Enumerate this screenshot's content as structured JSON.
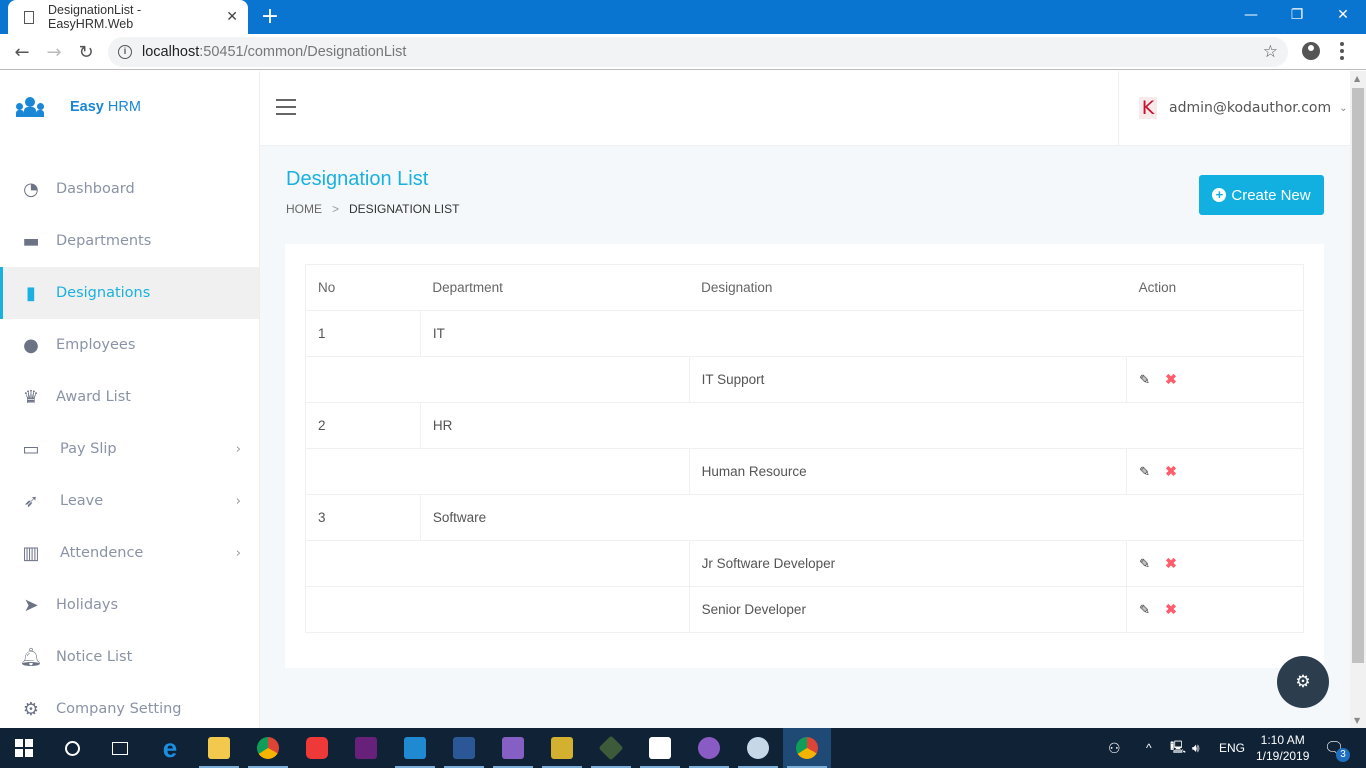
{
  "browser": {
    "tab_title": "DesignationList - EasyHRM.Web",
    "url_host": "localhost",
    "url_rest": ":50451/common/DesignationList",
    "new_tab": "+",
    "close_tab": "✕"
  },
  "brand": {
    "bold": "Easy",
    "rest": " HRM"
  },
  "sidebar": {
    "items": [
      {
        "label": "Dashboard",
        "icon": "dashboard-icon",
        "glyph": "◔",
        "active": false,
        "submenu": false
      },
      {
        "label": "Departments",
        "icon": "briefcase-icon",
        "glyph": "▬",
        "active": false,
        "submenu": false
      },
      {
        "label": "Designations",
        "icon": "suitcase-icon",
        "glyph": "▮",
        "active": true,
        "submenu": false
      },
      {
        "label": "Employees",
        "icon": "users-icon",
        "glyph": "●",
        "active": false,
        "submenu": false
      },
      {
        "label": "Award List",
        "icon": "trophy-icon",
        "glyph": "♛",
        "active": false,
        "submenu": false
      },
      {
        "label": "Pay Slip",
        "icon": "money-icon",
        "glyph": "▭",
        "active": false,
        "submenu": true
      },
      {
        "label": "Leave",
        "icon": "rocket-icon",
        "glyph": "➶",
        "active": false,
        "submenu": true
      },
      {
        "label": "Attendence",
        "icon": "bar-chart-icon",
        "glyph": "▥",
        "active": false,
        "submenu": true
      },
      {
        "label": "Holidays",
        "icon": "paper-plane-icon",
        "glyph": "➤",
        "active": false,
        "submenu": false
      },
      {
        "label": "Notice List",
        "icon": "bell-icon",
        "glyph": "🔔︎",
        "active": false,
        "submenu": false
      },
      {
        "label": "Company Setting",
        "icon": "gear-icon",
        "glyph": "⚙",
        "active": false,
        "submenu": false
      }
    ],
    "chevron": "›"
  },
  "topbar": {
    "user_initial": "K",
    "user_email": "admin@kodauthor.com",
    "caret": "⌄"
  },
  "page": {
    "title": "Designation List",
    "breadcrumb": {
      "home": "HOME",
      "separator": ">",
      "current": "DESIGNATION LIST"
    },
    "create_button": "Create New"
  },
  "table": {
    "headers": [
      "No",
      "Department",
      "Designation",
      "Action"
    ],
    "groups": [
      {
        "no": "1",
        "department": "IT",
        "designations": [
          "IT Support"
        ]
      },
      {
        "no": "2",
        "department": "HR",
        "designations": [
          "Human Resource"
        ]
      },
      {
        "no": "3",
        "department": "Software",
        "designations": [
          "Jr Software Developer",
          "Senior Developer"
        ]
      }
    ],
    "edit_glyph": "✎",
    "delete_glyph": "✖"
  },
  "fab_glyph": "⚙",
  "taskbar": {
    "apps": [
      "start",
      "cortana",
      "task-view",
      "edge",
      "file-explorer",
      "chrome",
      "vivaldi",
      "visual-studio",
      "vscode",
      "word",
      "visual-studio-preview",
      "tool",
      "terminal-app",
      "photos",
      "github-desktop",
      "paint",
      "chrome-active"
    ],
    "language": "ENG",
    "time": "1:10 AM",
    "date": "1/19/2019",
    "notification_count": "3"
  }
}
